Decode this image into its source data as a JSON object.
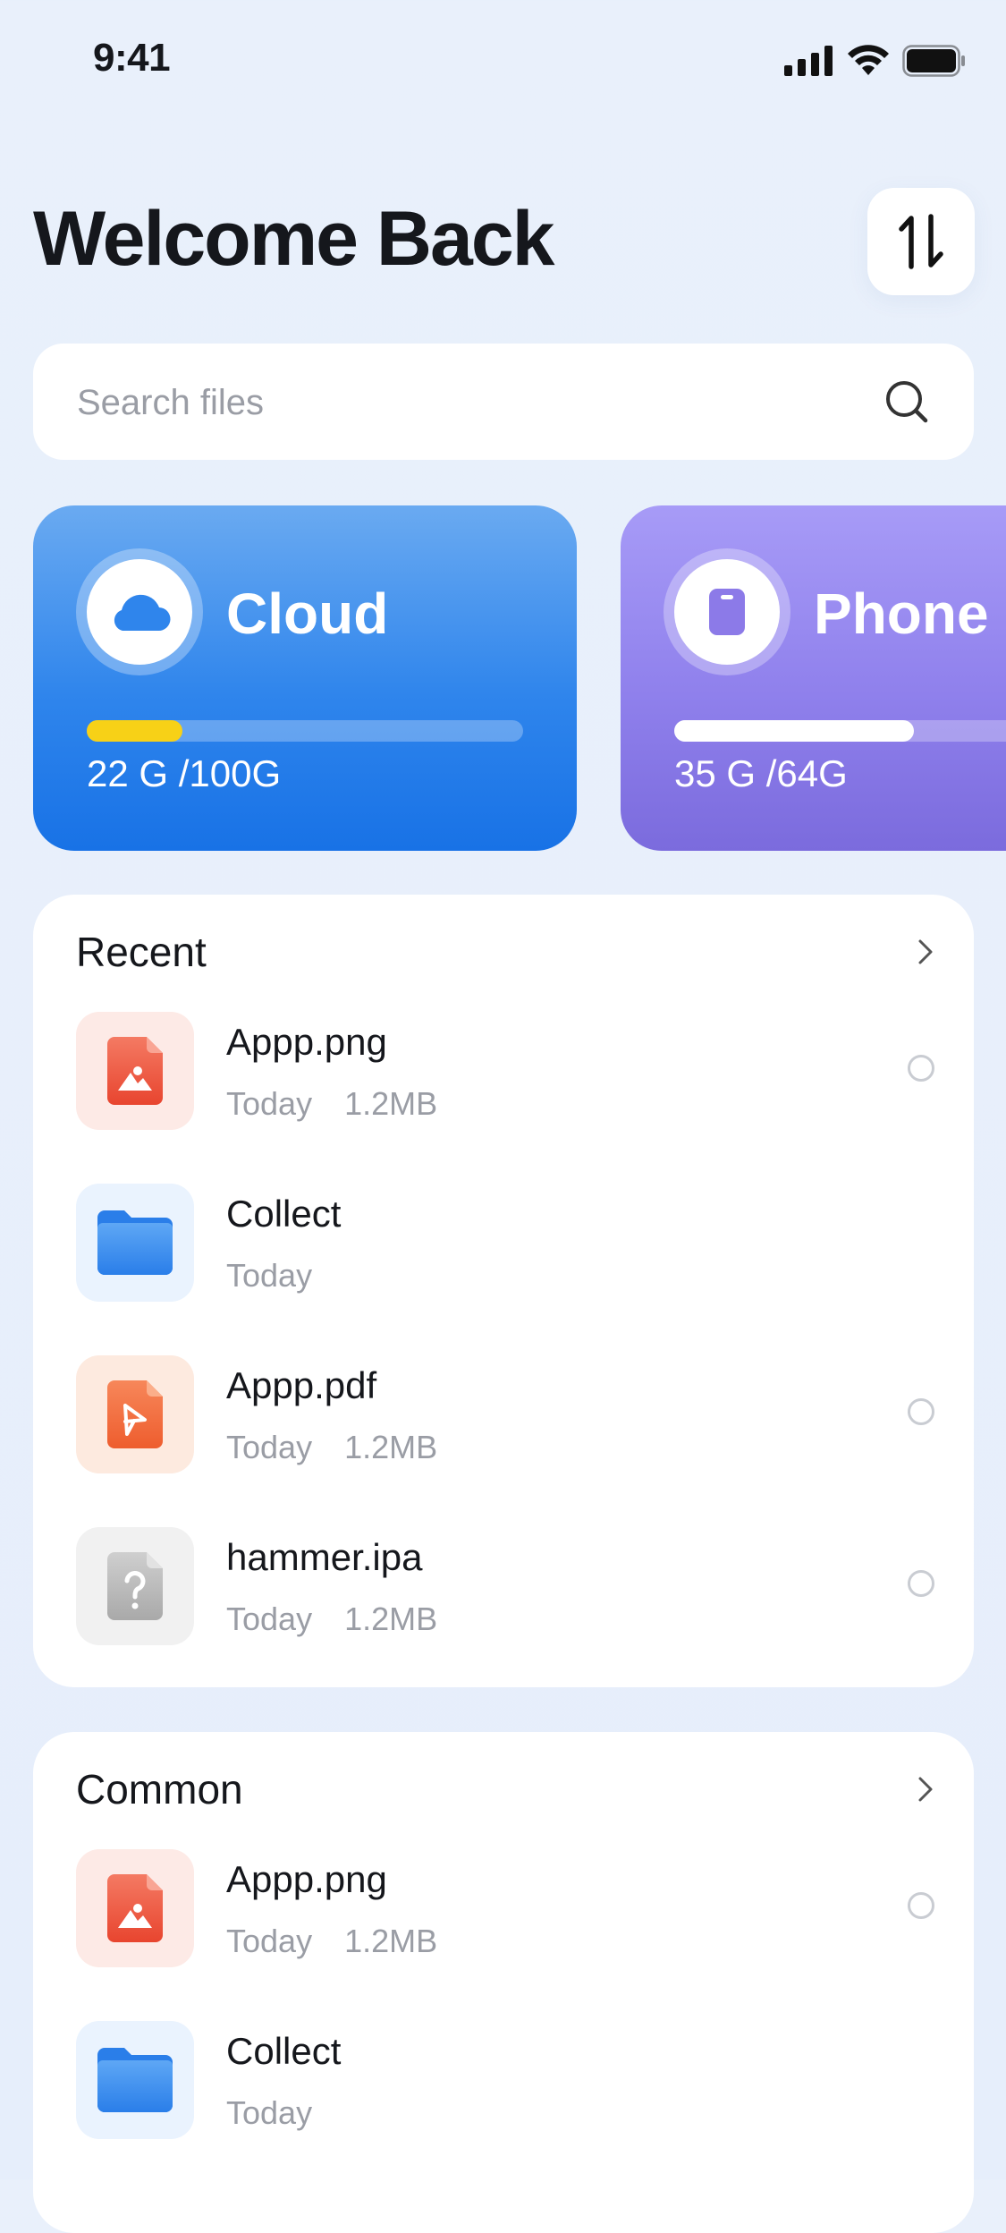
{
  "status_bar": {
    "time": "9:41"
  },
  "header": {
    "title": "Welcome Back"
  },
  "search": {
    "placeholder": "Search files"
  },
  "storage": [
    {
      "name": "Cloud",
      "usage": "22 G /100G",
      "used_fraction": 0.22,
      "fill_color": "#f7d117",
      "icon": "cloud-icon"
    },
    {
      "name": "Phone",
      "usage": "35 G /64G",
      "used_fraction": 0.55,
      "fill_color": "#ffffff",
      "icon": "phone-icon"
    }
  ],
  "recent": {
    "title": "Recent",
    "items": [
      {
        "name": "Appp.png",
        "date": "Today",
        "size": "1.2MB",
        "type": "image"
      },
      {
        "name": "Collect",
        "date": "Today",
        "size": "",
        "type": "folder"
      },
      {
        "name": "Appp.pdf",
        "date": "Today",
        "size": "1.2MB",
        "type": "pdf"
      },
      {
        "name": "hammer.ipa",
        "date": "Today",
        "size": "1.2MB",
        "type": "unknown"
      }
    ]
  },
  "common": {
    "title": "Common",
    "items": [
      {
        "name": "Appp.png",
        "date": "Today",
        "size": "1.2MB",
        "type": "image"
      },
      {
        "name": "Collect",
        "date": "Today",
        "size": "",
        "type": "folder"
      }
    ]
  },
  "colors": {
    "accent_blue": "#1872e6",
    "accent_purple": "#7b6bdd",
    "image_icon": "#ef5b45",
    "pdf_icon": "#f06a3c",
    "folder_icon": "#3a8ff0",
    "unknown_icon": "#b9b9b9"
  }
}
